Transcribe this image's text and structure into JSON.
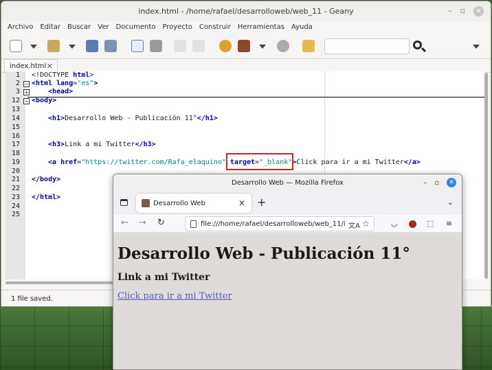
{
  "geany": {
    "title": "index.html - /home/rafael/desarrolloweb/web_11 - Geany",
    "menu": [
      "Archivo",
      "Editar",
      "Buscar",
      "Ver",
      "Documento",
      "Proyecto",
      "Construir",
      "Herramientas",
      "Ayuda"
    ],
    "search_value": "",
    "tab_name": "index.html",
    "status": "1 file saved.",
    "line_numbers": [
      "1",
      "2",
      "3",
      "12",
      "13",
      "14",
      "15",
      "16",
      "17",
      "18",
      "19",
      "20",
      "21",
      "22",
      "23",
      "24",
      "25"
    ],
    "code": {
      "l1_a": "<!DOCTYPE ",
      "l1_b": "html",
      "l1_c": ">",
      "l2_tag": "<html",
      "l2_attr": " lang",
      "l2_eq": "=",
      "l2_val": "\"es\"",
      "l2_close": ">",
      "l3": "<head>",
      "l12": "<body>",
      "l14_open": "<h1>",
      "l14_text": "Desarrollo Web - Publicación 11°",
      "l14_close": "</h1>",
      "l17_open": "<h3>",
      "l17_text": "Link a mi Twitter",
      "l17_close": "</h3>",
      "l19_a": "<a",
      "l19_href": " href",
      "l19_eq": "=",
      "l19_hval": "\"https://twitter.com/Rafa_elaquino\"",
      "l19_target": " target",
      "l19_eq2": "=",
      "l19_tval": "\"_blank\"",
      "l19_gt": ">",
      "l19_text": "Click para ir a mi Twitter",
      "l19_close": "</a>",
      "l21": "</body>",
      "l23": "</html>"
    }
  },
  "firefox": {
    "title": "Desarrollo Web — Mozilla Firefox",
    "tab_title": "Desarrollo Web",
    "url": "file:///home/rafael/desarrolloweb/web_11/i",
    "page": {
      "h1": "Desarrollo Web - Publicación 11°",
      "h3": "Link a mi Twitter",
      "link": "Click para ir a mi Twitter"
    }
  },
  "colors": {
    "highlight_box": "#d42020",
    "firefox_accent": "#3584e4",
    "link": "#5757c8",
    "tag": "#000090",
    "string": "#008080"
  }
}
